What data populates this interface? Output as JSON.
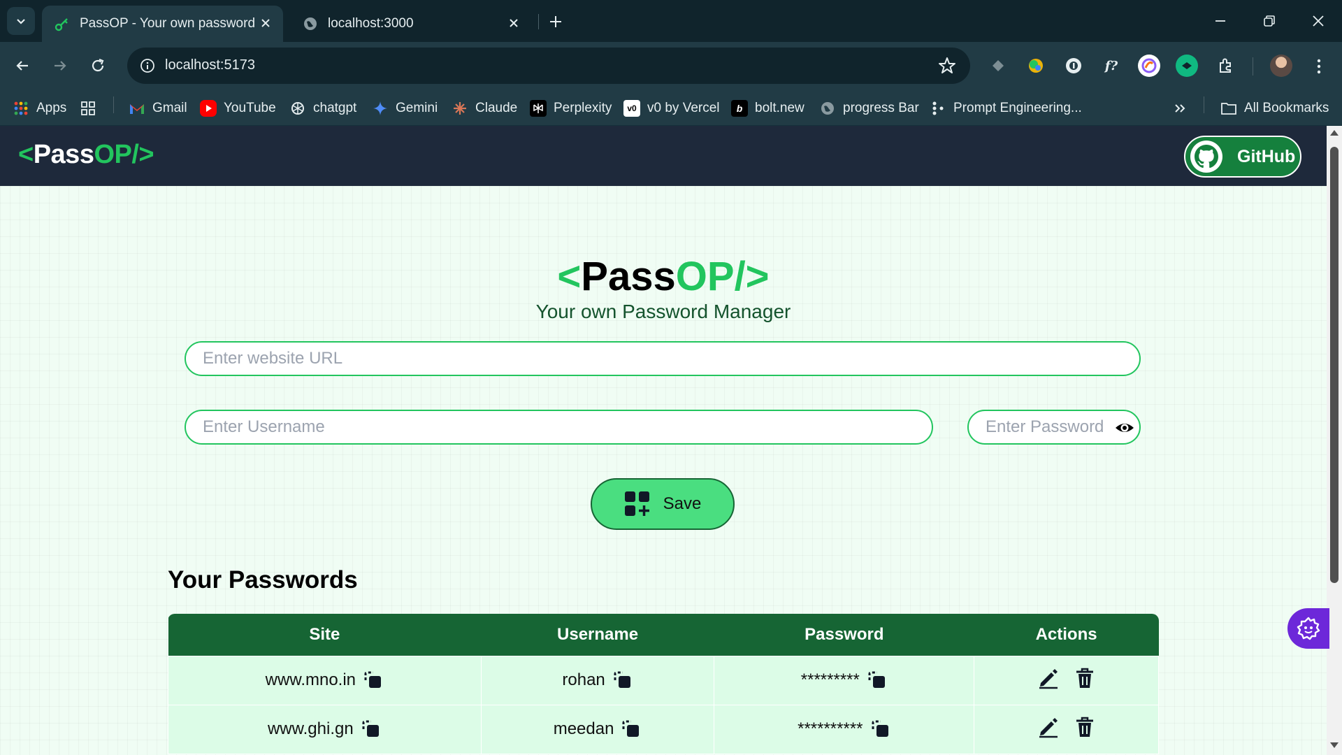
{
  "browser": {
    "tabs": [
      {
        "title": "PassOP - Your own password m",
        "active": true,
        "icon": "key-icon"
      },
      {
        "title": "localhost:3000",
        "active": false,
        "icon": "globe-icon"
      }
    ],
    "url": "localhost:5173",
    "bookmarks": [
      {
        "label": "Apps",
        "icon": "apps-grid-icon"
      },
      {
        "label": "",
        "icon": "tab-groups-icon"
      },
      {
        "label": "Gmail",
        "icon": "gmail-icon"
      },
      {
        "label": "YouTube",
        "icon": "youtube-icon"
      },
      {
        "label": "chatgpt",
        "icon": "chatgpt-icon"
      },
      {
        "label": "Gemini",
        "icon": "gemini-icon"
      },
      {
        "label": "Claude",
        "icon": "claude-icon"
      },
      {
        "label": "Perplexity",
        "icon": "perplexity-icon"
      },
      {
        "label": "v0 by Vercel",
        "icon": "v0-icon"
      },
      {
        "label": "bolt.new",
        "icon": "bolt-icon"
      },
      {
        "label": "progress Bar",
        "icon": "globe-icon"
      },
      {
        "label": "Prompt Engineering...",
        "icon": "prompt-icon"
      }
    ],
    "all_bookmarks_label": "All Bookmarks",
    "extensions": [
      "puzzle-ext-icon",
      "color-ext-icon",
      "password-ext-icon",
      "fx-ext-icon",
      "swirl-ext-icon",
      "chat-ext-icon",
      "extensions-icon"
    ]
  },
  "app": {
    "logo": {
      "open": "<",
      "pass": "Pass",
      "op": "OP/>"
    },
    "github_label": "GitHub",
    "hero": {
      "open": "<",
      "pass": "Pass",
      "op": "OP/>",
      "subtitle": "Your own Password Manager"
    },
    "form": {
      "site_placeholder": "Enter website URL",
      "username_placeholder": "Enter Username",
      "password_placeholder": "Enter Password",
      "save_label": "Save"
    },
    "passwords_heading": "Your Passwords",
    "table": {
      "headers": [
        "Site",
        "Username",
        "Password",
        "Actions"
      ],
      "rows": [
        {
          "site": "www.mno.in",
          "username": "rohan",
          "password": "*********"
        },
        {
          "site": "www.ghi.gn",
          "username": "meedan",
          "password": "**********"
        }
      ]
    }
  },
  "colors": {
    "brand_green": "#22c55e",
    "nav_bg": "#1e293b",
    "table_header": "#166534",
    "row_bg": "#dcfce7",
    "save_bg": "#4ade80"
  }
}
